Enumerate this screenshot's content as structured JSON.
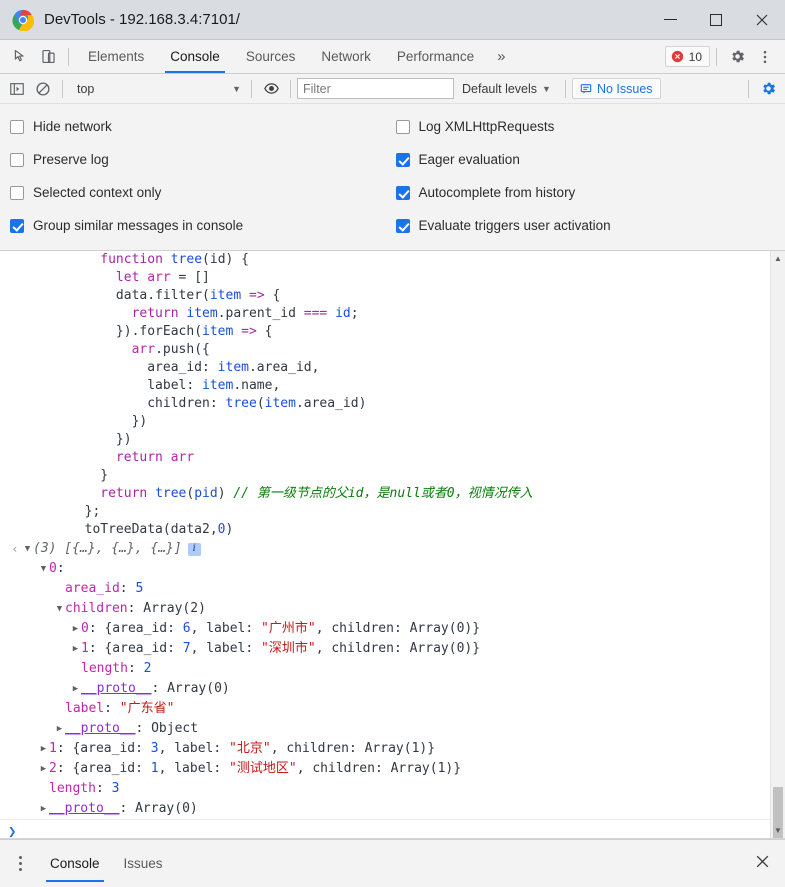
{
  "window": {
    "title": "DevTools - 192.168.3.4:7101/",
    "logo_icon": "chrome-logo-icon",
    "minimize_icon": "minimize-icon",
    "maximize_icon": "maximize-icon",
    "close_icon": "close-icon"
  },
  "tabstrip": {
    "inspect_icon": "inspect-element-icon",
    "device_icon": "device-toolbar-icon",
    "tabs": [
      {
        "label": "Elements",
        "active": false
      },
      {
        "label": "Console",
        "active": true
      },
      {
        "label": "Sources",
        "active": false
      },
      {
        "label": "Network",
        "active": false
      },
      {
        "label": "Performance",
        "active": false
      }
    ],
    "more_tabs_label": "»",
    "error_count": "10",
    "error_icon": "error-circle-icon",
    "settings_icon": "gear-icon",
    "menu_icon": "kebab-menu-icon"
  },
  "console_toolbar": {
    "sidebar_icon": "console-sidebar-icon",
    "clear_icon": "clear-console-icon",
    "context": "top",
    "context_caret": "▼",
    "eye_icon": "live-expression-eye-icon",
    "filter_placeholder": "Filter",
    "filter_value": "",
    "levels_label": "Default levels",
    "levels_caret": "▼",
    "issues_label": "No Issues",
    "issues_icon": "issues-message-icon",
    "settings_icon": "gear-icon"
  },
  "settings": {
    "left": [
      {
        "label": "Hide network",
        "checked": false
      },
      {
        "label": "Preserve log",
        "checked": false
      },
      {
        "label": "Selected context only",
        "checked": false
      },
      {
        "label": "Group similar messages in console",
        "checked": true
      }
    ],
    "right": [
      {
        "label": "Log XMLHttpRequests",
        "checked": false
      },
      {
        "label": "Eager evaluation",
        "checked": true
      },
      {
        "label": "Autocomplete from history",
        "checked": true
      },
      {
        "label": "Evaluate triggers user activation",
        "checked": true
      }
    ]
  },
  "console": {
    "code_lines": [
      [
        {
          "t": "          ",
          "c": "pl"
        },
        {
          "t": "function",
          "c": "kw"
        },
        {
          "t": " ",
          "c": "pl"
        },
        {
          "t": "tree",
          "c": "fn"
        },
        {
          "t": "(",
          "c": "pl"
        },
        {
          "t": "id",
          "c": "pl"
        },
        {
          "t": ") {",
          "c": "pl"
        }
      ],
      [
        {
          "t": "            ",
          "c": "pl"
        },
        {
          "t": "let",
          "c": "kw"
        },
        {
          "t": " ",
          "c": "pl"
        },
        {
          "t": "arr",
          "c": "prop"
        },
        {
          "t": " = []",
          "c": "pl"
        }
      ],
      [
        {
          "t": "            ",
          "c": "pl"
        },
        {
          "t": "data",
          "c": "pl"
        },
        {
          "t": ".",
          "c": "pl"
        },
        {
          "t": "filter",
          "c": "pl"
        },
        {
          "t": "(",
          "c": "pl"
        },
        {
          "t": "item",
          "c": "fn"
        },
        {
          "t": " ",
          "c": "pl"
        },
        {
          "t": "=>",
          "c": "kw"
        },
        {
          "t": " {",
          "c": "pl"
        }
      ],
      [
        {
          "t": "              ",
          "c": "pl"
        },
        {
          "t": "return",
          "c": "kw"
        },
        {
          "t": " ",
          "c": "pl"
        },
        {
          "t": "item",
          "c": "fn"
        },
        {
          "t": ".parent_id ",
          "c": "pl"
        },
        {
          "t": "===",
          "c": "kw"
        },
        {
          "t": " ",
          "c": "pl"
        },
        {
          "t": "id",
          "c": "fn"
        },
        {
          "t": ";",
          "c": "pl"
        }
      ],
      [
        {
          "t": "            }).",
          "c": "pl"
        },
        {
          "t": "forEach",
          "c": "pl"
        },
        {
          "t": "(",
          "c": "pl"
        },
        {
          "t": "item",
          "c": "fn"
        },
        {
          "t": " ",
          "c": "pl"
        },
        {
          "t": "=>",
          "c": "kw"
        },
        {
          "t": " {",
          "c": "pl"
        }
      ],
      [
        {
          "t": "              ",
          "c": "pl"
        },
        {
          "t": "arr",
          "c": "prop"
        },
        {
          "t": ".push({",
          "c": "pl"
        }
      ],
      [
        {
          "t": "                area_id: ",
          "c": "pl"
        },
        {
          "t": "item",
          "c": "fn"
        },
        {
          "t": ".area_id,",
          "c": "pl"
        }
      ],
      [
        {
          "t": "                label: ",
          "c": "pl"
        },
        {
          "t": "item",
          "c": "fn"
        },
        {
          "t": ".name,",
          "c": "pl"
        }
      ],
      [
        {
          "t": "                children: ",
          "c": "pl"
        },
        {
          "t": "tree",
          "c": "fn"
        },
        {
          "t": "(",
          "c": "pl"
        },
        {
          "t": "item",
          "c": "fn"
        },
        {
          "t": ".area_id)",
          "c": "pl"
        }
      ],
      [
        {
          "t": "              })",
          "c": "pl"
        }
      ],
      [
        {
          "t": "            })",
          "c": "pl"
        }
      ],
      [
        {
          "t": "            ",
          "c": "pl"
        },
        {
          "t": "return",
          "c": "kw"
        },
        {
          "t": " ",
          "c": "pl"
        },
        {
          "t": "arr",
          "c": "prop"
        }
      ],
      [
        {
          "t": "          }",
          "c": "pl"
        }
      ],
      [
        {
          "t": "          ",
          "c": "pl"
        },
        {
          "t": "return",
          "c": "kw"
        },
        {
          "t": " ",
          "c": "pl"
        },
        {
          "t": "tree",
          "c": "fn"
        },
        {
          "t": "(",
          "c": "pl"
        },
        {
          "t": "pid",
          "c": "fn"
        },
        {
          "t": ") ",
          "c": "pl"
        },
        {
          "t": "// 第一级节点的父id，是null或者0，视情况传入",
          "c": "cmt"
        }
      ],
      [
        {
          "t": "        };",
          "c": "pl"
        }
      ],
      [
        {
          "t": "        toTreeData(data2,",
          "c": "pl"
        },
        {
          "t": "0",
          "c": "num"
        },
        {
          "t": ")",
          "c": "pl"
        }
      ]
    ],
    "tree_lines": [
      {
        "indent": 0,
        "marker": "result",
        "tri": "open",
        "parts": [
          {
            "t": "(3) [{…}, {…}, {…}]",
            "c": "ital"
          }
        ],
        "info_badge": true
      },
      {
        "indent": 1,
        "tri": "open",
        "parts": [
          {
            "t": "0",
            "c": "prop"
          },
          {
            "t": ":",
            "c": "pl"
          }
        ]
      },
      {
        "indent": 2,
        "tri": "none",
        "parts": [
          {
            "t": "area_id",
            "c": "prop"
          },
          {
            "t": ": ",
            "c": "pl"
          },
          {
            "t": "5",
            "c": "num"
          }
        ]
      },
      {
        "indent": 2,
        "tri": "open",
        "parts": [
          {
            "t": "children",
            "c": "prop"
          },
          {
            "t": ": Array(2)",
            "c": "pl"
          }
        ]
      },
      {
        "indent": 3,
        "tri": "closed",
        "parts": [
          {
            "t": "0",
            "c": "prop"
          },
          {
            "t": ": {area_id: ",
            "c": "pl"
          },
          {
            "t": "6",
            "c": "num"
          },
          {
            "t": ", label: ",
            "c": "pl"
          },
          {
            "t": "\"广州市\"",
            "c": "str"
          },
          {
            "t": ", children: Array(0)}",
            "c": "pl"
          }
        ]
      },
      {
        "indent": 3,
        "tri": "closed",
        "parts": [
          {
            "t": "1",
            "c": "prop"
          },
          {
            "t": ": {area_id: ",
            "c": "pl"
          },
          {
            "t": "7",
            "c": "num"
          },
          {
            "t": ", label: ",
            "c": "pl"
          },
          {
            "t": "\"深圳市\"",
            "c": "str"
          },
          {
            "t": ", children: Array(0)}",
            "c": "pl"
          }
        ]
      },
      {
        "indent": 3,
        "tri": "none",
        "parts": [
          {
            "t": "length",
            "c": "prop"
          },
          {
            "t": ": ",
            "c": "pl"
          },
          {
            "t": "2",
            "c": "num"
          }
        ]
      },
      {
        "indent": 3,
        "tri": "closed",
        "parts": [
          {
            "t": "__proto__",
            "c": "proto"
          },
          {
            "t": ": Array(0)",
            "c": "pl"
          }
        ]
      },
      {
        "indent": 2,
        "tri": "none",
        "parts": [
          {
            "t": "label",
            "c": "prop"
          },
          {
            "t": ": ",
            "c": "pl"
          },
          {
            "t": "\"广东省\"",
            "c": "str"
          }
        ]
      },
      {
        "indent": 2,
        "tri": "closed",
        "parts": [
          {
            "t": "__proto__",
            "c": "proto"
          },
          {
            "t": ": Object",
            "c": "pl"
          }
        ]
      },
      {
        "indent": 1,
        "tri": "closed",
        "parts": [
          {
            "t": "1",
            "c": "prop"
          },
          {
            "t": ": {area_id: ",
            "c": "pl"
          },
          {
            "t": "3",
            "c": "num"
          },
          {
            "t": ", label: ",
            "c": "pl"
          },
          {
            "t": "\"北京\"",
            "c": "str"
          },
          {
            "t": ", children: Array(1)}",
            "c": "pl"
          }
        ]
      },
      {
        "indent": 1,
        "tri": "closed",
        "parts": [
          {
            "t": "2",
            "c": "prop"
          },
          {
            "t": ": {area_id: ",
            "c": "pl"
          },
          {
            "t": "1",
            "c": "num"
          },
          {
            "t": ", label: ",
            "c": "pl"
          },
          {
            "t": "\"测试地区\"",
            "c": "str"
          },
          {
            "t": ", children: Array(1)}",
            "c": "pl"
          }
        ]
      },
      {
        "indent": 1,
        "tri": "none",
        "parts": [
          {
            "t": "length",
            "c": "prop"
          },
          {
            "t": ": ",
            "c": "pl"
          },
          {
            "t": "3",
            "c": "num"
          }
        ]
      },
      {
        "indent": 1,
        "tri": "closed",
        "parts": [
          {
            "t": "__proto__",
            "c": "proto"
          },
          {
            "t": ": Array(0)",
            "c": "pl"
          }
        ]
      }
    ],
    "prompt_caret": "❯"
  },
  "drawer": {
    "menu_icon": "kebab-menu-icon",
    "tabs": [
      {
        "label": "Console",
        "active": true
      },
      {
        "label": "Issues",
        "active": false
      }
    ],
    "close_icon": "close-icon"
  }
}
